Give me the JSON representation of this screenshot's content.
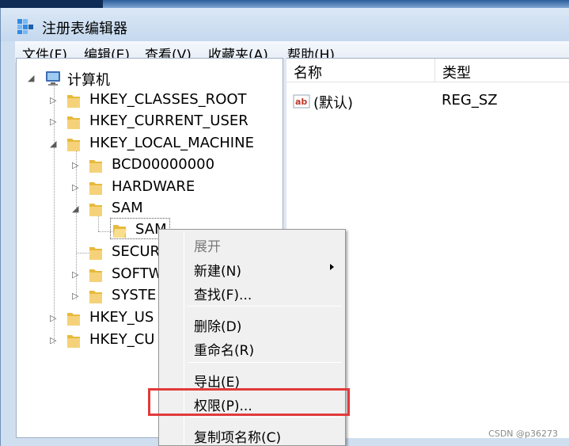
{
  "window": {
    "title": "注册表编辑器"
  },
  "menubar": {
    "items": [
      {
        "label": "文件(F)"
      },
      {
        "label": "编辑(E)"
      },
      {
        "label": "查看(V)"
      },
      {
        "label": "收藏夹(A)"
      },
      {
        "label": "帮助(H)"
      }
    ]
  },
  "tree": {
    "root": {
      "label": "计算机",
      "expanded": true
    },
    "nodes": [
      {
        "label": "HKEY_CLASSES_ROOT",
        "expanded": false
      },
      {
        "label": "HKEY_CURRENT_USER",
        "expanded": false
      },
      {
        "label": "HKEY_LOCAL_MACHINE",
        "expanded": true
      },
      {
        "label": "BCD00000000",
        "expanded": false
      },
      {
        "label": "HARDWARE",
        "expanded": false
      },
      {
        "label": "SAM",
        "expanded": true
      },
      {
        "label": "SAM",
        "selected": true
      },
      {
        "label": "SECUR"
      },
      {
        "label": "SOFTW"
      },
      {
        "label": "SYSTE"
      },
      {
        "label": "HKEY_US"
      },
      {
        "label": "HKEY_CU"
      }
    ]
  },
  "list": {
    "columns": [
      {
        "label": "名称"
      },
      {
        "label": "类型"
      }
    ],
    "rows": [
      {
        "name": "(默认)",
        "type": "REG_SZ",
        "icon": "string-value-icon"
      }
    ]
  },
  "context_menu": {
    "items": [
      {
        "label": "展开",
        "disabled": true
      },
      {
        "label": "新建(N)",
        "submenu": true
      },
      {
        "label": "查找(F)..."
      },
      {
        "label": "删除(D)"
      },
      {
        "label": "重命名(R)"
      },
      {
        "label": "导出(E)"
      },
      {
        "label": "权限(P)...",
        "highlighted": true
      },
      {
        "label": "复制项名称(C)"
      }
    ]
  },
  "colors": {
    "highlight": "#e23a3a",
    "folder": "#e8b93c"
  },
  "watermark": "CSDN @p36273"
}
